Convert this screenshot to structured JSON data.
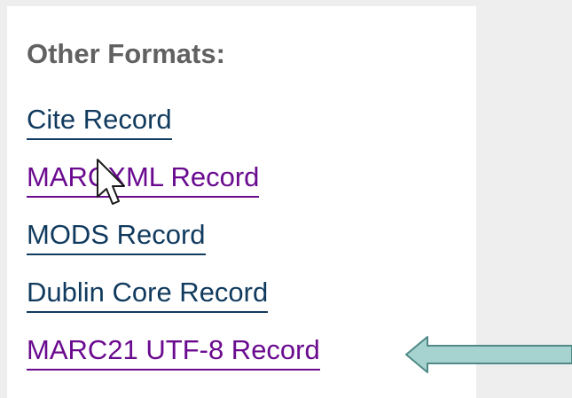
{
  "other_formats": {
    "heading": "Other Formats:",
    "links": [
      {
        "label": "Cite Record",
        "visited": false
      },
      {
        "label": "MARCXML Record",
        "visited": true
      },
      {
        "label": "MODS Record",
        "visited": false
      },
      {
        "label": "Dublin Core Record",
        "visited": false
      },
      {
        "label": "MARC21 UTF-8 Record",
        "visited": true
      }
    ]
  },
  "colors": {
    "page_background": "#eeeeee",
    "panel_background": "#ffffff",
    "heading": "#616161",
    "link": "#103a5e",
    "visited_link": "#6a0a8f",
    "arrow_fill": "#a6d2cf",
    "arrow_outline": "#4f8a86"
  },
  "icons": {
    "cursor": "mouse-pointer-icon",
    "callout": "left-arrow-icon"
  }
}
